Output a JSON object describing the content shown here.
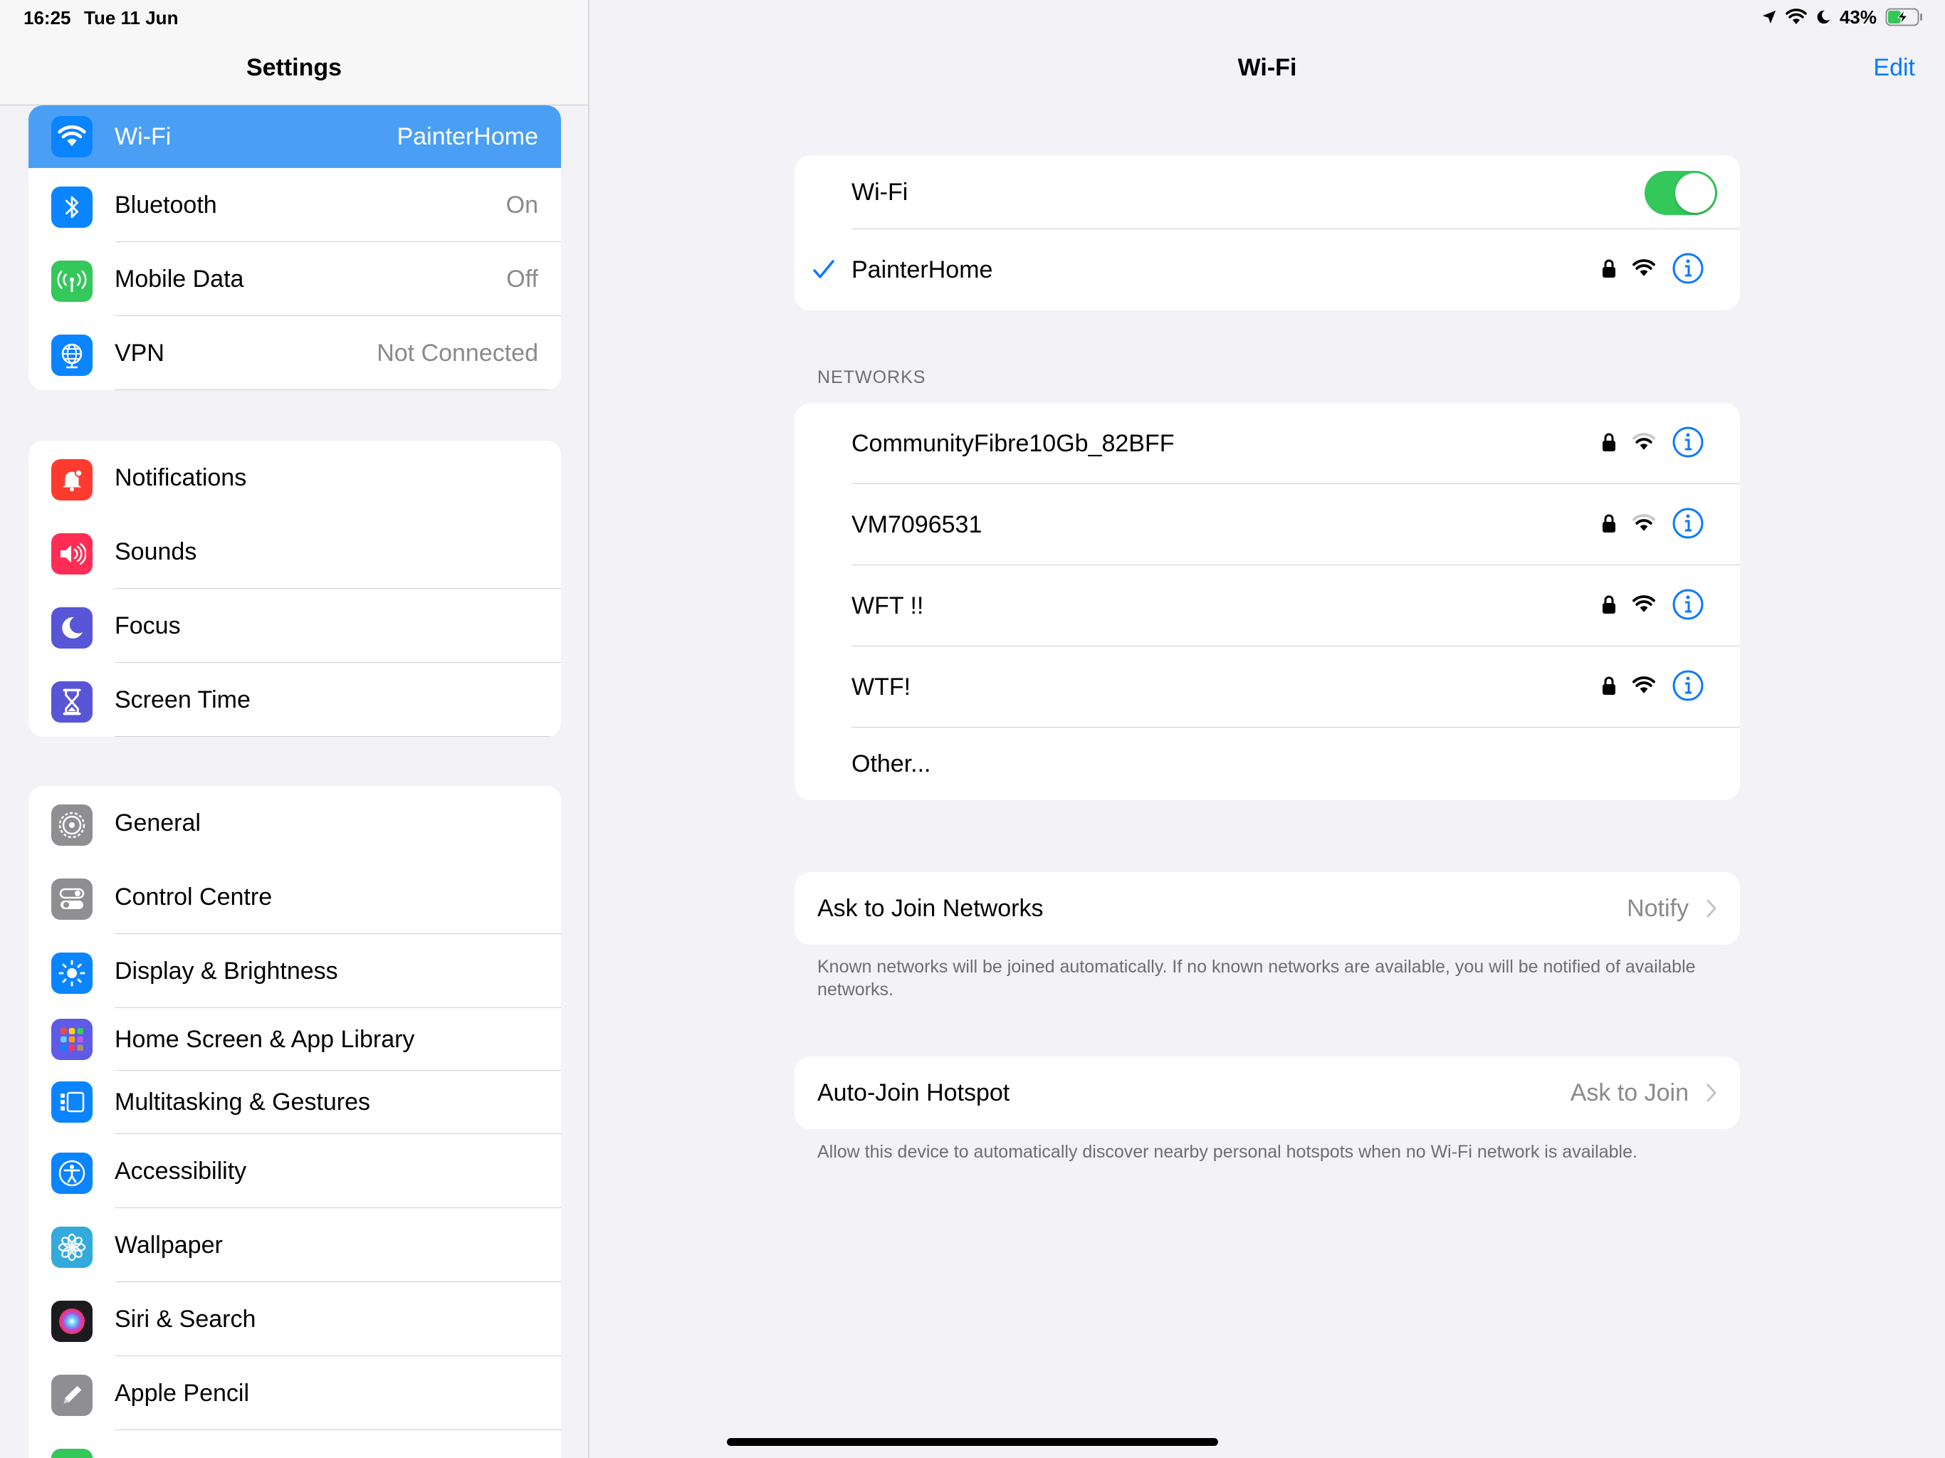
{
  "status_bar": {
    "time": "16:25",
    "date": "Tue 11 Jun",
    "battery_percent": "43%",
    "battery_level": 0.43,
    "icons": [
      "location-arrow-icon",
      "wifi-icon",
      "moon-icon",
      "battery-charging-icon"
    ]
  },
  "sidebar": {
    "title": "Settings",
    "groups": [
      {
        "items": [
          {
            "label": "Wi-Fi",
            "value": "PainterHome",
            "icon": "wifi-icon",
            "color": "#0a84ff",
            "selected": true
          },
          {
            "label": "Bluetooth",
            "value": "On",
            "icon": "bluetooth-icon",
            "color": "#0a84ff"
          },
          {
            "label": "Mobile Data",
            "value": "Off",
            "icon": "antenna-icon",
            "color": "#34c759"
          },
          {
            "label": "VPN",
            "value": "Not Connected",
            "icon": "globe-icon",
            "color": "#0a84ff"
          }
        ]
      },
      {
        "items": [
          {
            "label": "Notifications",
            "icon": "bell-icon",
            "color": "#ff3b30"
          },
          {
            "label": "Sounds",
            "icon": "speaker-icon",
            "color": "#ff2d55"
          },
          {
            "label": "Focus",
            "icon": "moon-icon",
            "color": "#5856d6"
          },
          {
            "label": "Screen Time",
            "icon": "hourglass-icon",
            "color": "#5856d6"
          }
        ]
      },
      {
        "items": [
          {
            "label": "General",
            "icon": "gear-icon",
            "color": "#8e8e93"
          },
          {
            "label": "Control Centre",
            "icon": "switches-icon",
            "color": "#8e8e93"
          },
          {
            "label": "Display & Brightness",
            "icon": "sun-icon",
            "color": "#0a84ff"
          },
          {
            "label": "Home Screen & App Library",
            "icon": "app-grid-icon",
            "color": "#5e5ce6"
          },
          {
            "label": "Multitasking & Gestures",
            "icon": "multitasking-icon",
            "color": "#0a84ff"
          },
          {
            "label": "Accessibility",
            "icon": "accessibility-icon",
            "color": "#0a84ff"
          },
          {
            "label": "Wallpaper",
            "icon": "flower-icon",
            "color": "#34aadc"
          },
          {
            "label": "Siri & Search",
            "icon": "siri-icon",
            "color": "#1c1c1e"
          },
          {
            "label": "Apple Pencil",
            "icon": "pencil-icon",
            "color": "#8e8e93"
          }
        ]
      }
    ]
  },
  "main": {
    "title": "Wi-Fi",
    "edit_label": "Edit",
    "wifi_toggle_label": "Wi-Fi",
    "wifi_enabled": true,
    "connected_network": "PainterHome",
    "networks_header": "NETWORKS",
    "networks": [
      {
        "name": "CommunityFibre10Gb_82BFF",
        "locked": true,
        "signal": "medium"
      },
      {
        "name": "VM7096531",
        "locked": true,
        "signal": "medium"
      },
      {
        "name": "WFT !!",
        "locked": true,
        "signal": "full"
      },
      {
        "name": "WTF!",
        "locked": true,
        "signal": "full"
      }
    ],
    "other_label": "Other...",
    "ask_to_join": {
      "label": "Ask to Join Networks",
      "value": "Notify",
      "footnote": "Known networks will be joined automatically. If no known networks are available, you will be notified of available networks."
    },
    "auto_join": {
      "label": "Auto-Join Hotspot",
      "value": "Ask to Join",
      "footnote": "Allow this device to automatically discover nearby personal hotspots when no Wi-Fi network is available."
    }
  }
}
